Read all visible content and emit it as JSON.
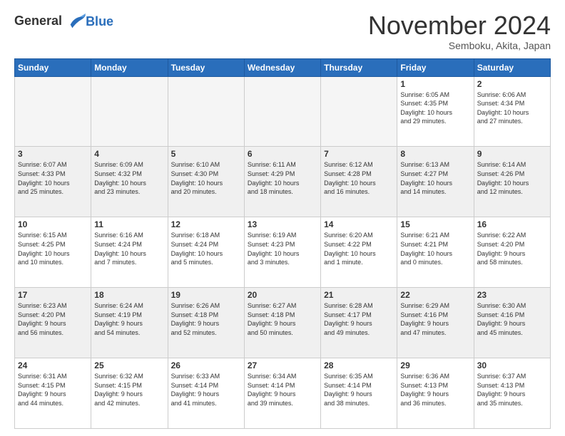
{
  "header": {
    "logo_line1": "General",
    "logo_line2": "Blue",
    "month_title": "November 2024",
    "location": "Semboku, Akita, Japan"
  },
  "weekdays": [
    "Sunday",
    "Monday",
    "Tuesday",
    "Wednesday",
    "Thursday",
    "Friday",
    "Saturday"
  ],
  "weeks": [
    [
      {
        "day": "",
        "info": ""
      },
      {
        "day": "",
        "info": ""
      },
      {
        "day": "",
        "info": ""
      },
      {
        "day": "",
        "info": ""
      },
      {
        "day": "",
        "info": ""
      },
      {
        "day": "1",
        "info": "Sunrise: 6:05 AM\nSunset: 4:35 PM\nDaylight: 10 hours\nand 29 minutes."
      },
      {
        "day": "2",
        "info": "Sunrise: 6:06 AM\nSunset: 4:34 PM\nDaylight: 10 hours\nand 27 minutes."
      }
    ],
    [
      {
        "day": "3",
        "info": "Sunrise: 6:07 AM\nSunset: 4:33 PM\nDaylight: 10 hours\nand 25 minutes."
      },
      {
        "day": "4",
        "info": "Sunrise: 6:09 AM\nSunset: 4:32 PM\nDaylight: 10 hours\nand 23 minutes."
      },
      {
        "day": "5",
        "info": "Sunrise: 6:10 AM\nSunset: 4:30 PM\nDaylight: 10 hours\nand 20 minutes."
      },
      {
        "day": "6",
        "info": "Sunrise: 6:11 AM\nSunset: 4:29 PM\nDaylight: 10 hours\nand 18 minutes."
      },
      {
        "day": "7",
        "info": "Sunrise: 6:12 AM\nSunset: 4:28 PM\nDaylight: 10 hours\nand 16 minutes."
      },
      {
        "day": "8",
        "info": "Sunrise: 6:13 AM\nSunset: 4:27 PM\nDaylight: 10 hours\nand 14 minutes."
      },
      {
        "day": "9",
        "info": "Sunrise: 6:14 AM\nSunset: 4:26 PM\nDaylight: 10 hours\nand 12 minutes."
      }
    ],
    [
      {
        "day": "10",
        "info": "Sunrise: 6:15 AM\nSunset: 4:25 PM\nDaylight: 10 hours\nand 10 minutes."
      },
      {
        "day": "11",
        "info": "Sunrise: 6:16 AM\nSunset: 4:24 PM\nDaylight: 10 hours\nand 7 minutes."
      },
      {
        "day": "12",
        "info": "Sunrise: 6:18 AM\nSunset: 4:24 PM\nDaylight: 10 hours\nand 5 minutes."
      },
      {
        "day": "13",
        "info": "Sunrise: 6:19 AM\nSunset: 4:23 PM\nDaylight: 10 hours\nand 3 minutes."
      },
      {
        "day": "14",
        "info": "Sunrise: 6:20 AM\nSunset: 4:22 PM\nDaylight: 10 hours\nand 1 minute."
      },
      {
        "day": "15",
        "info": "Sunrise: 6:21 AM\nSunset: 4:21 PM\nDaylight: 10 hours\nand 0 minutes."
      },
      {
        "day": "16",
        "info": "Sunrise: 6:22 AM\nSunset: 4:20 PM\nDaylight: 9 hours\nand 58 minutes."
      }
    ],
    [
      {
        "day": "17",
        "info": "Sunrise: 6:23 AM\nSunset: 4:20 PM\nDaylight: 9 hours\nand 56 minutes."
      },
      {
        "day": "18",
        "info": "Sunrise: 6:24 AM\nSunset: 4:19 PM\nDaylight: 9 hours\nand 54 minutes."
      },
      {
        "day": "19",
        "info": "Sunrise: 6:26 AM\nSunset: 4:18 PM\nDaylight: 9 hours\nand 52 minutes."
      },
      {
        "day": "20",
        "info": "Sunrise: 6:27 AM\nSunset: 4:18 PM\nDaylight: 9 hours\nand 50 minutes."
      },
      {
        "day": "21",
        "info": "Sunrise: 6:28 AM\nSunset: 4:17 PM\nDaylight: 9 hours\nand 49 minutes."
      },
      {
        "day": "22",
        "info": "Sunrise: 6:29 AM\nSunset: 4:16 PM\nDaylight: 9 hours\nand 47 minutes."
      },
      {
        "day": "23",
        "info": "Sunrise: 6:30 AM\nSunset: 4:16 PM\nDaylight: 9 hours\nand 45 minutes."
      }
    ],
    [
      {
        "day": "24",
        "info": "Sunrise: 6:31 AM\nSunset: 4:15 PM\nDaylight: 9 hours\nand 44 minutes."
      },
      {
        "day": "25",
        "info": "Sunrise: 6:32 AM\nSunset: 4:15 PM\nDaylight: 9 hours\nand 42 minutes."
      },
      {
        "day": "26",
        "info": "Sunrise: 6:33 AM\nSunset: 4:14 PM\nDaylight: 9 hours\nand 41 minutes."
      },
      {
        "day": "27",
        "info": "Sunrise: 6:34 AM\nSunset: 4:14 PM\nDaylight: 9 hours\nand 39 minutes."
      },
      {
        "day": "28",
        "info": "Sunrise: 6:35 AM\nSunset: 4:14 PM\nDaylight: 9 hours\nand 38 minutes."
      },
      {
        "day": "29",
        "info": "Sunrise: 6:36 AM\nSunset: 4:13 PM\nDaylight: 9 hours\nand 36 minutes."
      },
      {
        "day": "30",
        "info": "Sunrise: 6:37 AM\nSunset: 4:13 PM\nDaylight: 9 hours\nand 35 minutes."
      }
    ]
  ]
}
